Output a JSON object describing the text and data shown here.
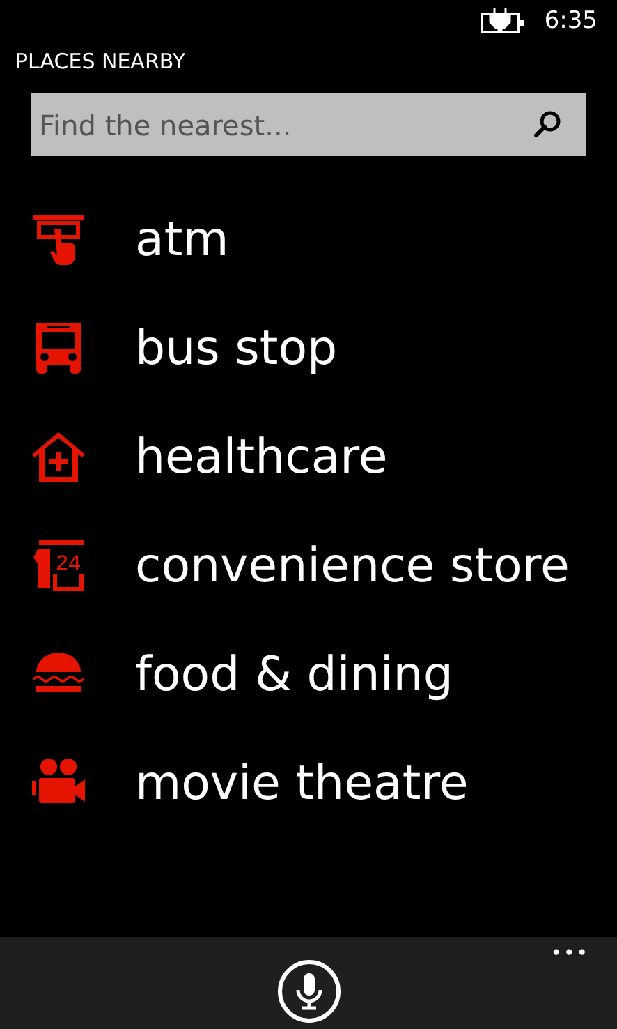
{
  "status_bar": {
    "time": "6:35"
  },
  "header": {
    "title": "PLACES NEARBY"
  },
  "search": {
    "placeholder": "Find the nearest..."
  },
  "places": [
    {
      "kind": "atm",
      "label": "atm"
    },
    {
      "kind": "bus",
      "label": "bus stop"
    },
    {
      "kind": "health",
      "label": "healthcare"
    },
    {
      "kind": "store",
      "label": "convenience store",
      "icon_text": "24"
    },
    {
      "kind": "food",
      "label": "food & dining"
    },
    {
      "kind": "movie",
      "label": "movie theatre"
    }
  ],
  "app_bar": {
    "more": "•••"
  }
}
